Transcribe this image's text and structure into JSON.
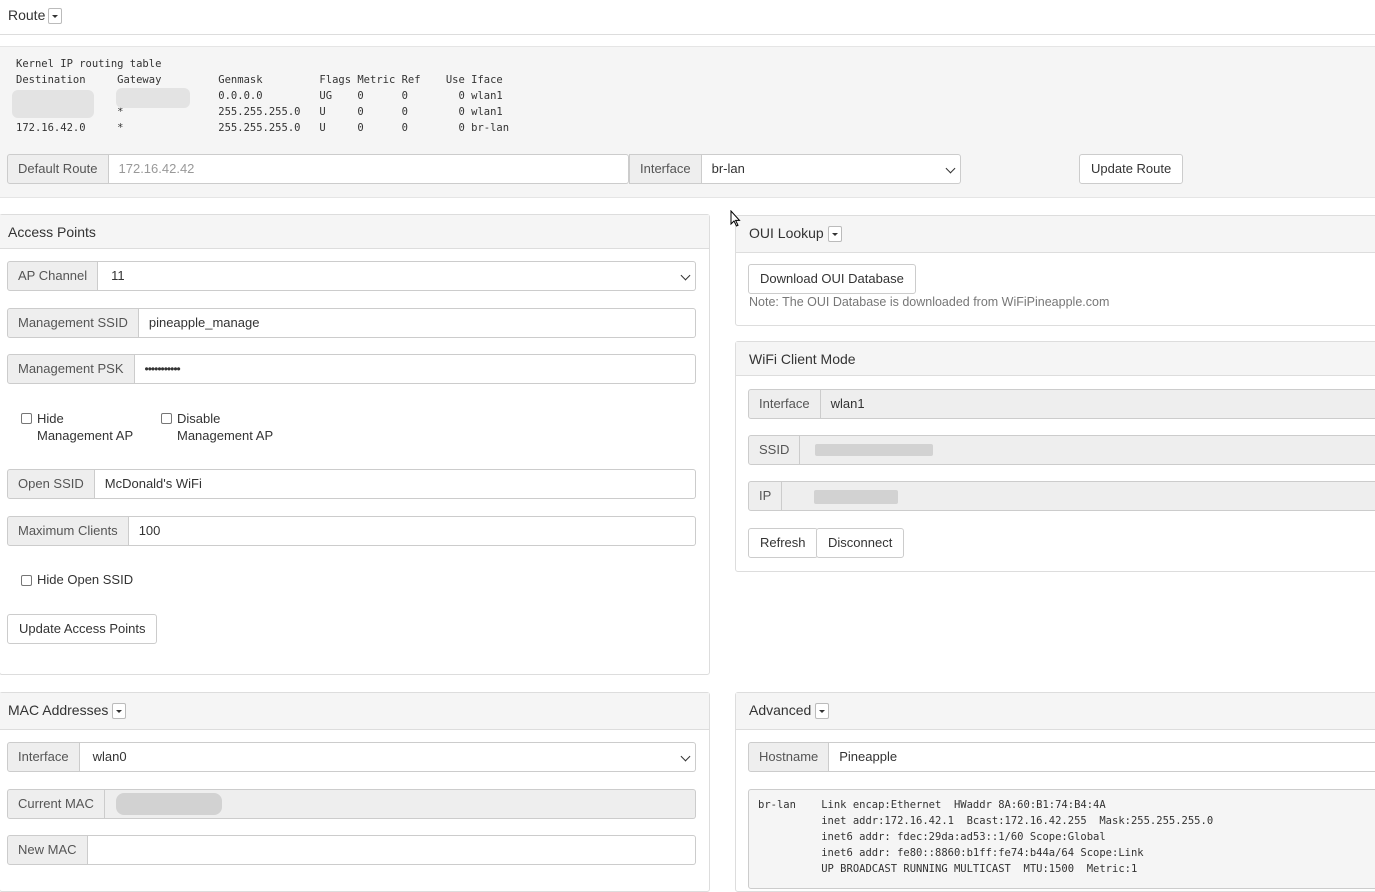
{
  "route": {
    "title": "Route",
    "table_text": "Kernel IP routing table\nDestination     Gateway         Genmask         Flags Metric Ref    Use Iface\ndefa            1               0.0.0.0         UG    0      0        0 wlan1\n                *               255.255.255.0   U     0      0        0 wlan1\n172.16.42.0     *               255.255.255.0   U     0      0        0 br-lan",
    "default_route_label": "Default Route",
    "default_route_placeholder": "172.16.42.42",
    "interface_label": "Interface",
    "interface_value": "br-lan",
    "update_button": "Update Route"
  },
  "access_points": {
    "title": "Access Points",
    "ap_channel_label": "AP Channel",
    "ap_channel_value": "11",
    "mgmt_ssid_label": "Management SSID",
    "mgmt_ssid_value": "pineapple_manage",
    "mgmt_psk_label": "Management PSK",
    "mgmt_psk_value": "•••••••••••",
    "hide_mgmt_label_1": "Hide",
    "hide_mgmt_label_2": "Management AP",
    "disable_mgmt_label_1": "Disable",
    "disable_mgmt_label_2": "Management AP",
    "open_ssid_label": "Open SSID",
    "open_ssid_value": "McDonald's WiFi",
    "max_clients_label": "Maximum Clients",
    "max_clients_value": "100",
    "hide_open_ssid_label": "Hide Open SSID",
    "update_button": "Update Access Points"
  },
  "oui_lookup": {
    "title": "OUI Lookup",
    "download_button": "Download OUI Database",
    "note": "Note: The OUI Database is downloaded from WiFiPineapple.com"
  },
  "wifi_client": {
    "title": "WiFi Client Mode",
    "interface_label": "Interface",
    "interface_value": "wlan1",
    "ssid_label": "SSID",
    "ip_label": "IP",
    "refresh_button": "Refresh",
    "disconnect_button": "Disconnect"
  },
  "mac_addresses": {
    "title": "MAC Addresses",
    "interface_label": "Interface",
    "interface_value": "wlan0",
    "current_mac_label": "Current MAC",
    "new_mac_label": "New MAC"
  },
  "advanced": {
    "title": "Advanced",
    "hostname_label": "Hostname",
    "hostname_value": "Pineapple",
    "ifconfig_text": "br-lan    Link encap:Ethernet  HWaddr 8A:60:B1:74:B4:4A\n          inet addr:172.16.42.1  Bcast:172.16.42.255  Mask:255.255.255.0\n          inet6 addr: fdec:29da:ad53::1/60 Scope:Global\n          inet6 addr: fe80::8860:b1ff:fe74:b44a/64 Scope:Link\n          UP BROADCAST RUNNING MULTICAST  MTU:1500  Metric:1"
  }
}
